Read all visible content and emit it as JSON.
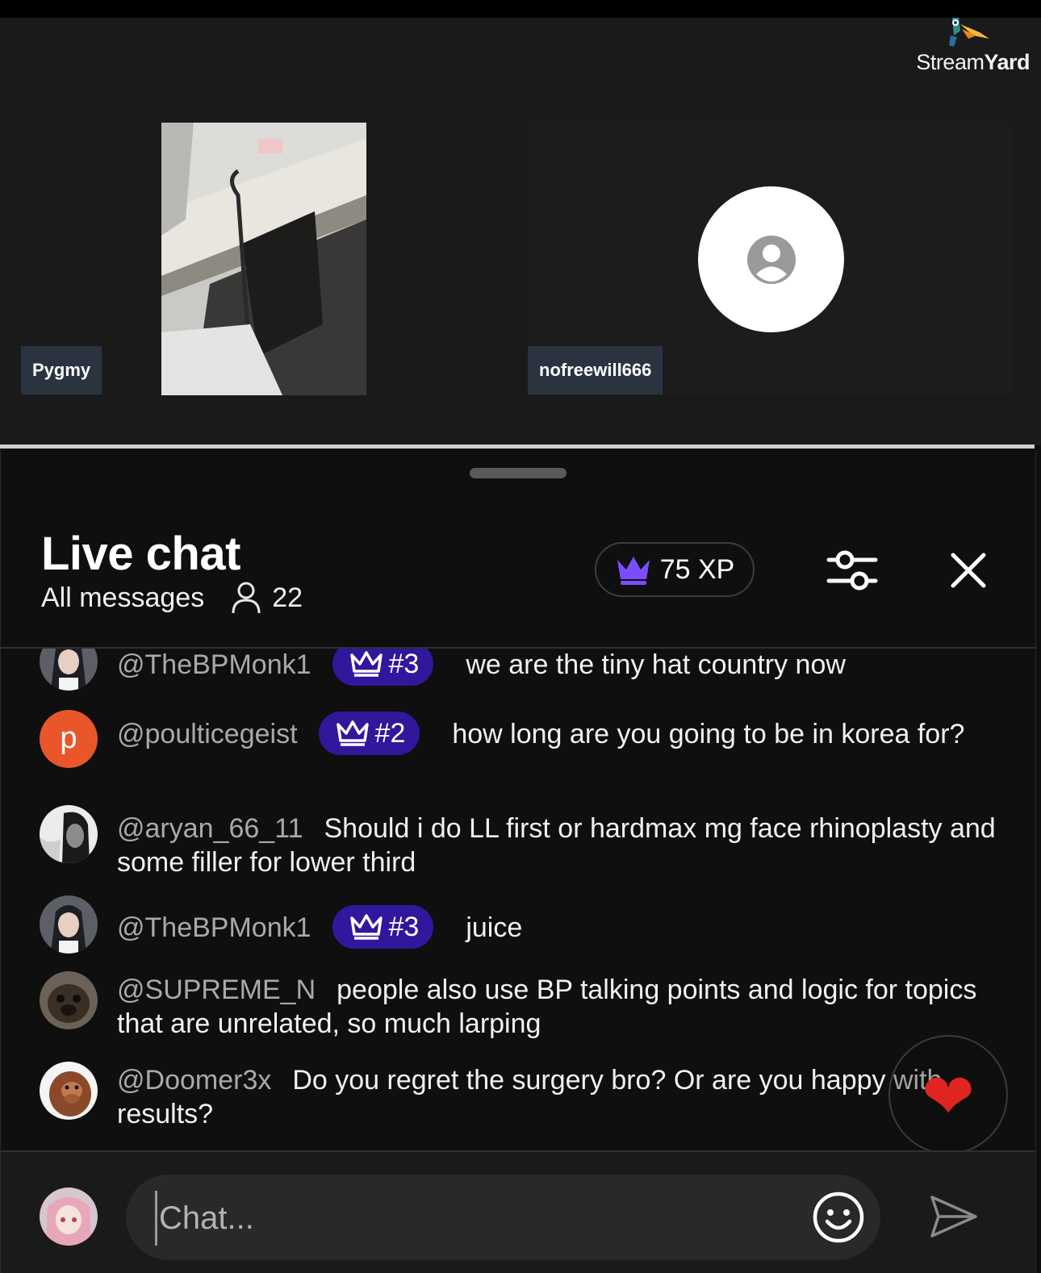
{
  "stream": {
    "brand_light": "Stream",
    "brand_bold": "Yard",
    "participants": [
      {
        "name": "Pygmy"
      },
      {
        "name": "nofreewill666"
      }
    ]
  },
  "chat": {
    "title": "Live chat",
    "filter_label": "All messages",
    "viewer_count": "22",
    "xp": "75 XP",
    "messages": [
      {
        "author": "@TheBPMonk1",
        "badge": "#3",
        "text": "we are the tiny hat country now",
        "avatar": "anime-girl"
      },
      {
        "author": "@poulticegeist",
        "badge": "#2",
        "text": "how long are you going to be in korea for?",
        "avatar": "letter-p",
        "avatar_letter": "p"
      },
      {
        "author": "@aryan_66_11",
        "badge": "",
        "text": "Should i do LL first or hardmax mg face rhinoplasty and some filler for lower third",
        "avatar": "bw-portrait"
      },
      {
        "author": "@TheBPMonk1",
        "badge": "#3",
        "text": "juice",
        "avatar": "anime-girl"
      },
      {
        "author": "@SUPREME_N",
        "badge": "",
        "text": "people also use BP talking points and logic for topics that are unrelated, so much larping",
        "avatar": "pug"
      },
      {
        "author": "@Doomer3x",
        "badge": "",
        "text": "Do you regret the surgery bro? Or are you happy with results?",
        "avatar": "monkey"
      }
    ],
    "input_placeholder": "Chat...",
    "reaction": "heart"
  },
  "colors": {
    "badge_bg": "#31179b",
    "crown": "#7b4dff",
    "avatar_p": "#e8562a",
    "heart": "#e0241f"
  }
}
